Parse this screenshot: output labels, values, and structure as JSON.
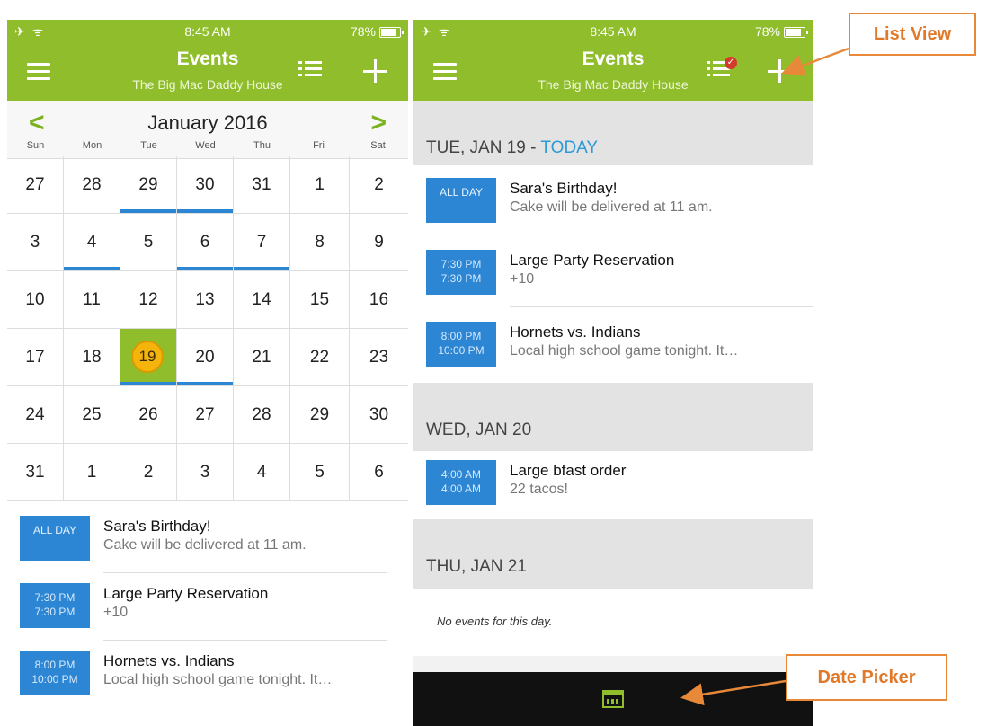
{
  "status_bar": {
    "time": "8:45 AM",
    "battery": "78%",
    "left_icons": "✈ ᯤ"
  },
  "app": {
    "title": "Events",
    "subtitle": "The Big Mac Daddy House"
  },
  "calendar": {
    "month_label": "January 2016",
    "prev_glyph": "<",
    "next_glyph": ">",
    "weekdays": [
      "Sun",
      "Mon",
      "Tue",
      "Wed",
      "Thu",
      "Fri",
      "Sat"
    ],
    "weeks": [
      [
        "27",
        "28",
        "29",
        "30",
        "31",
        "1",
        "2"
      ],
      [
        "3",
        "4",
        "5",
        "6",
        "7",
        "8",
        "9"
      ],
      [
        "10",
        "11",
        "12",
        "13",
        "14",
        "15",
        "16"
      ],
      [
        "17",
        "18",
        "19",
        "20",
        "21",
        "22",
        "23"
      ],
      [
        "24",
        "25",
        "26",
        "27",
        "28",
        "29",
        "30"
      ],
      [
        "31",
        "1",
        "2",
        "3",
        "4",
        "5",
        "6"
      ]
    ]
  },
  "day_events": [
    {
      "time_top": "ALL DAY",
      "time_bottom": "",
      "title": "Sara's Birthday!",
      "desc": "Cake will be delivered at 11 am."
    },
    {
      "time_top": "7:30 PM",
      "time_bottom": "7:30 PM",
      "title": "Large Party Reservation",
      "desc": "+10"
    },
    {
      "time_top": "8:00 PM",
      "time_bottom": "10:00 PM",
      "title": "Hornets vs. Indians",
      "desc": "Local high school game tonight. It…"
    }
  ],
  "list_view": {
    "days": [
      {
        "label": "TUE, JAN 19 - ",
        "today_label": "TODAY",
        "events": [
          {
            "time_top": "ALL DAY",
            "time_bottom": "",
            "title": "Sara's Birthday!",
            "desc": "Cake will be delivered at 11 am."
          },
          {
            "time_top": "7:30 PM",
            "time_bottom": "7:30 PM",
            "title": "Large Party Reservation",
            "desc": "+10"
          },
          {
            "time_top": "8:00 PM",
            "time_bottom": "10:00 PM",
            "title": "Hornets vs. Indians",
            "desc": "Local high school game tonight. It…"
          }
        ]
      },
      {
        "label": "WED, JAN 20",
        "events": [
          {
            "time_top": "4:00 AM",
            "time_bottom": "4:00 AM",
            "title": "Large bfast order",
            "desc": "22 tacos!"
          }
        ]
      },
      {
        "label": "THU, JAN 21",
        "no_events": "No events for this day."
      }
    ]
  },
  "annotations": {
    "list_view": "List View",
    "date_picker": "Date Picker"
  },
  "colors": {
    "brand_green": "#8fbd2b",
    "event_blue": "#2c86d4",
    "today_gold": "#f5b40c",
    "callout_orange": "#e8893a",
    "today_link": "#2c9ad7"
  },
  "icons": [
    "airplane-icon",
    "wifi-icon",
    "battery-icon",
    "hamburger-menu-icon",
    "list-view-icon",
    "add-icon",
    "chevron-left-icon",
    "chevron-right-icon",
    "date-picker-icon"
  ]
}
